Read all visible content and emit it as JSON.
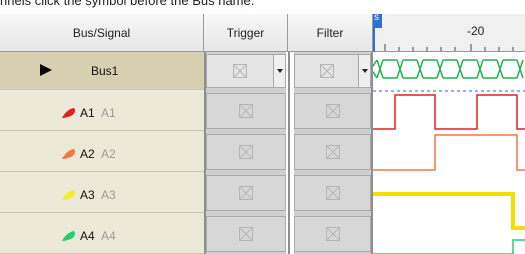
{
  "caption": "nnels click the      symbol before the Bus name.",
  "columns": {
    "bus_signal": "Bus/Signal",
    "trigger": "Trigger",
    "filter": "Filter"
  },
  "ruler_label": "-20",
  "marker_label": "s",
  "rows": [
    {
      "name": "Bus1",
      "alias": "",
      "kind": "bus",
      "color": "#000000"
    },
    {
      "name": "A1",
      "alias": "A1",
      "kind": "signal",
      "color": "#e02020"
    },
    {
      "name": "A2",
      "alias": "A2",
      "kind": "signal",
      "color": "#f07840"
    },
    {
      "name": "A3",
      "alias": "A3",
      "kind": "signal",
      "color": "#f0f020"
    },
    {
      "name": "A4",
      "alias": "A4",
      "kind": "signal",
      "color": "#20d070"
    }
  ]
}
